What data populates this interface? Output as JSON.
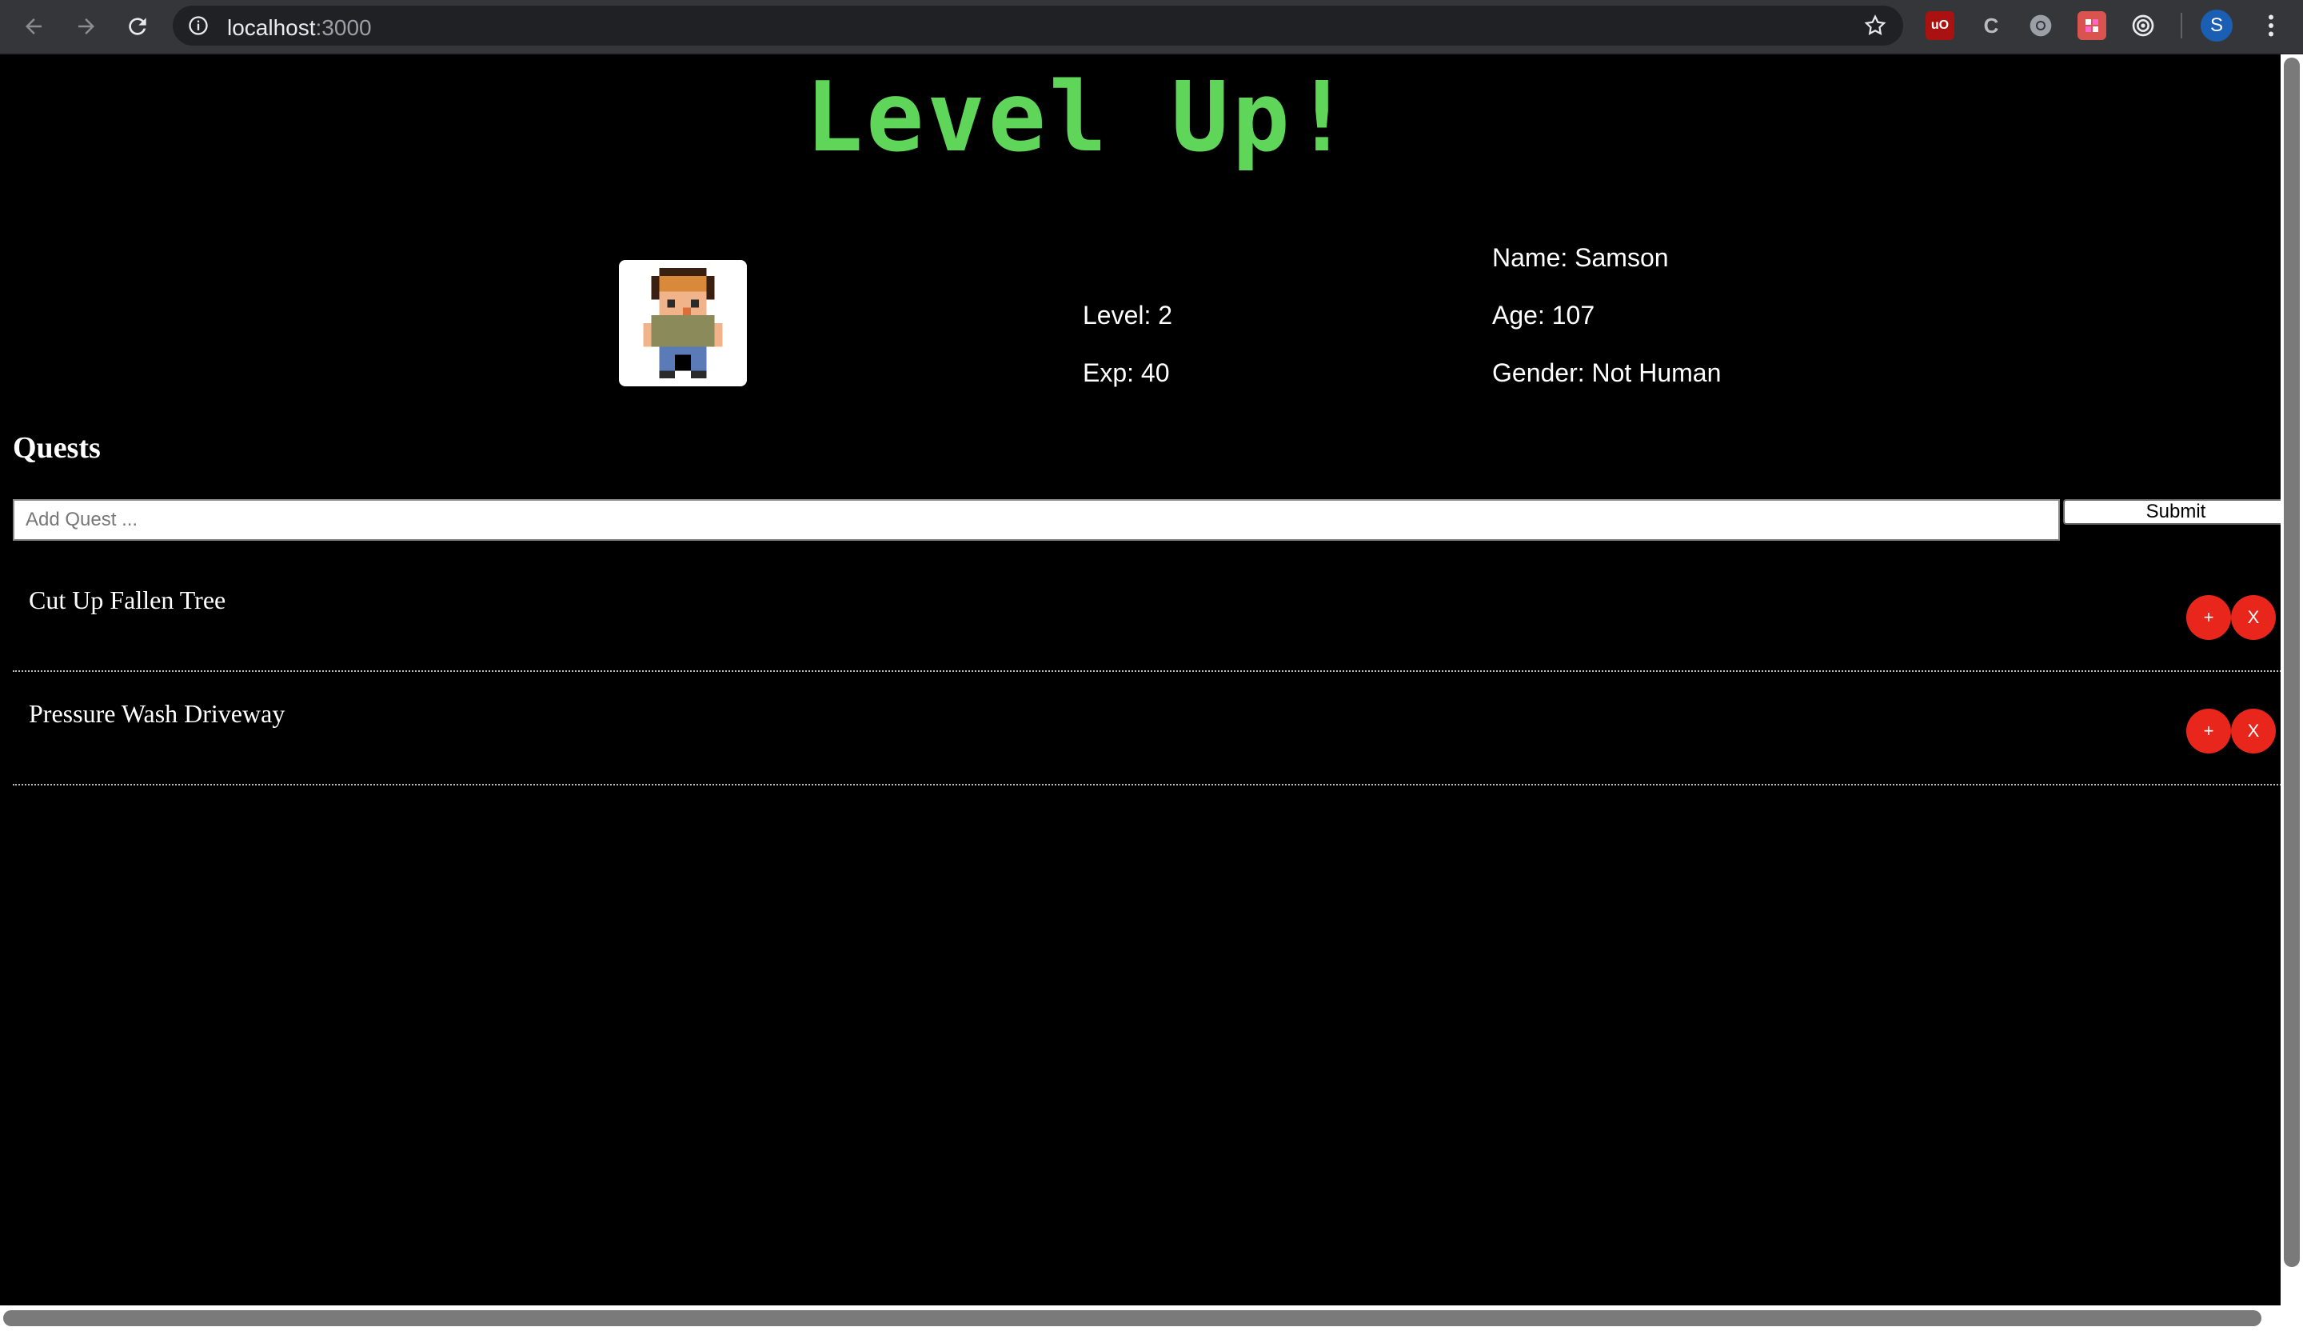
{
  "browser": {
    "url_host": "localhost",
    "url_port": ":3000",
    "profile_initial": "S",
    "extensions": [
      "ublock-icon",
      "c-extension-icon",
      "chrome-extension-icon",
      "puzzle-extension-icon",
      "target-extension-icon"
    ]
  },
  "app": {
    "title": "Level Up!"
  },
  "character": {
    "level": "Level: 2",
    "exp": "Exp: 40",
    "name": "Name: Samson",
    "age": "Age: 107",
    "gender": "Gender: Not Human"
  },
  "quests": {
    "heading": "Quests",
    "input_placeholder": "Add Quest ...",
    "submit_label": "Submit",
    "items": [
      {
        "name": "Cut Up Fallen Tree",
        "plus_label": "+",
        "remove_label": "X"
      },
      {
        "name": "Pressure Wash Driveway",
        "plus_label": "+",
        "remove_label": "X"
      }
    ]
  },
  "colors": {
    "title_green": "#5fd65a",
    "button_red": "#e8261c",
    "background": "#000000"
  }
}
